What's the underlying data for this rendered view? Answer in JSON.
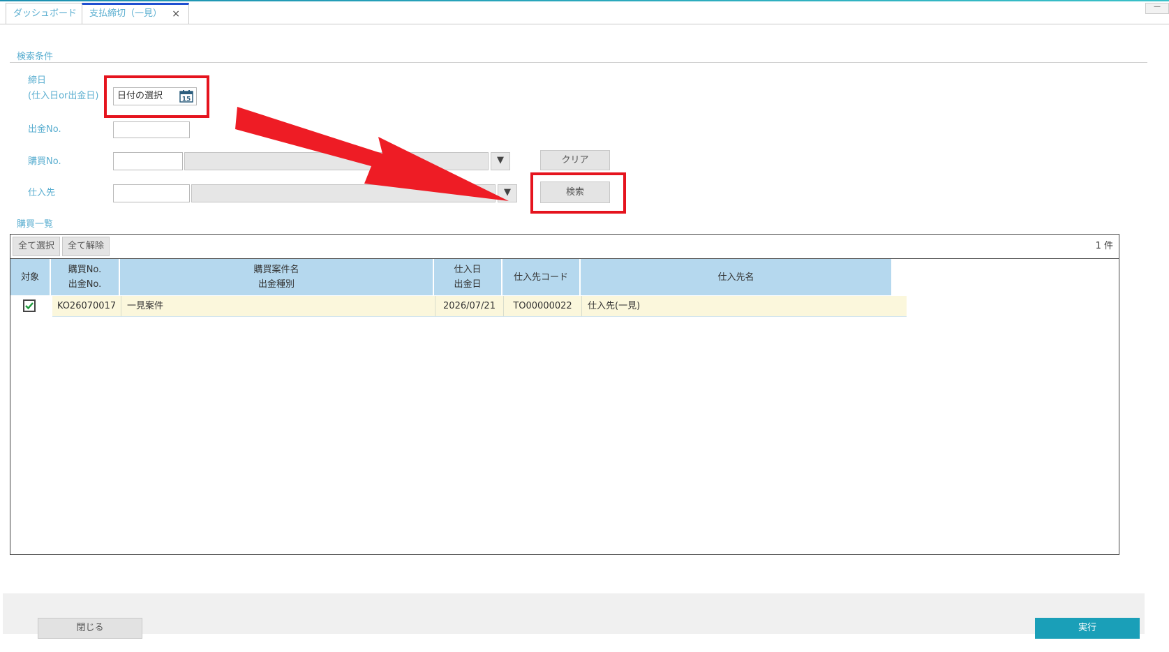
{
  "tabs": [
    {
      "label": "ダッシュボード"
    },
    {
      "label": "支払締切（一見）",
      "close": "×"
    }
  ],
  "window_min": "—",
  "search": {
    "section_title": "検索条件",
    "closing_date_label_1": "締日",
    "closing_date_label_2": "(仕入日or出金日)",
    "date_placeholder": "日付の選択",
    "calendar_day": "15",
    "payment_no_label": "出金No.",
    "purchase_no_label": "購買No.",
    "supplier_label": "仕入先",
    "dropdown_glyph": "▼",
    "clear_button": "クリア",
    "search_button": "検索"
  },
  "list": {
    "section_title": "購買一覧",
    "select_all": "全て選択",
    "deselect_all": "全て解除",
    "count": "1 件",
    "headers": {
      "target": "対象",
      "purchase_no": "購買No.",
      "payment_no": "出金No.",
      "case_name": "購買案件名",
      "payment_type": "出金種別",
      "purchase_date": "仕入日",
      "payment_date": "出金日",
      "supplier_code": "仕入先コード",
      "supplier_name": "仕入先名"
    },
    "rows": [
      {
        "checked": true,
        "purchase_no": "KO26070017",
        "case_name": "一見案件",
        "date": "2026/07/21",
        "supplier_code": "TO00000022",
        "supplier_name": "仕入先(一見)"
      }
    ]
  },
  "footer": {
    "close_button": "閉じる",
    "execute_button": "実行"
  },
  "colors": {
    "accent": "#1a9fb8",
    "label": "#5aaed0",
    "header_bg": "#b5d8ee",
    "row_bg": "#fbf7dc",
    "annotation_red": "#e5141e"
  }
}
